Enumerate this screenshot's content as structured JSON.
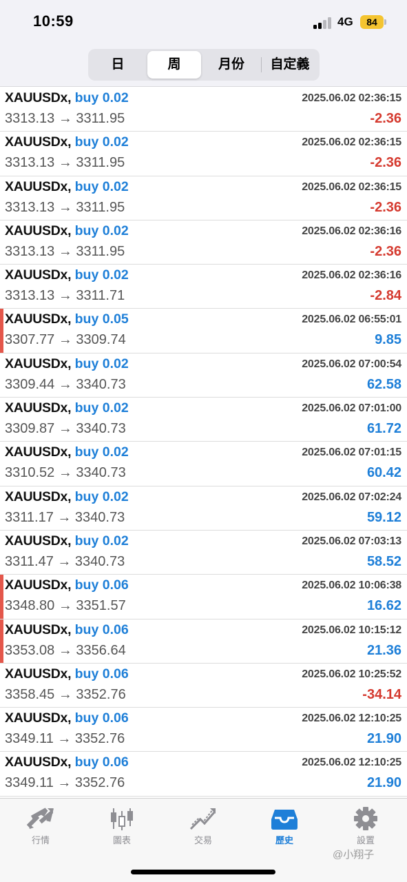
{
  "status": {
    "time": "10:59",
    "network": "4G",
    "battery": "84"
  },
  "period_tabs": [
    {
      "label": "日",
      "active": false
    },
    {
      "label": "周",
      "active": true
    },
    {
      "label": "月份",
      "active": false
    },
    {
      "label": "自定義",
      "active": false
    }
  ],
  "deals": [
    {
      "symbol": "XAUUSDx,",
      "type_volume": "buy 0.02",
      "time": "2025.06.02 02:36:15",
      "prices": "3313.13 → 3311.95",
      "profit": "-2.36",
      "profit_sign": "neg",
      "marked": false
    },
    {
      "symbol": "XAUUSDx,",
      "type_volume": "buy 0.02",
      "time": "2025.06.02 02:36:15",
      "prices": "3313.13 → 3311.95",
      "profit": "-2.36",
      "profit_sign": "neg",
      "marked": false
    },
    {
      "symbol": "XAUUSDx,",
      "type_volume": "buy 0.02",
      "time": "2025.06.02 02:36:15",
      "prices": "3313.13 → 3311.95",
      "profit": "-2.36",
      "profit_sign": "neg",
      "marked": false
    },
    {
      "symbol": "XAUUSDx,",
      "type_volume": "buy 0.02",
      "time": "2025.06.02 02:36:16",
      "prices": "3313.13 → 3311.95",
      "profit": "-2.36",
      "profit_sign": "neg",
      "marked": false
    },
    {
      "symbol": "XAUUSDx,",
      "type_volume": "buy 0.02",
      "time": "2025.06.02 02:36:16",
      "prices": "3313.13 → 3311.71",
      "profit": "-2.84",
      "profit_sign": "neg",
      "marked": false
    },
    {
      "symbol": "XAUUSDx,",
      "type_volume": "buy 0.05",
      "time": "2025.06.02 06:55:01",
      "prices": "3307.77 → 3309.74",
      "profit": "9.85",
      "profit_sign": "pos",
      "marked": true
    },
    {
      "symbol": "XAUUSDx,",
      "type_volume": "buy 0.02",
      "time": "2025.06.02 07:00:54",
      "prices": "3309.44 → 3340.73",
      "profit": "62.58",
      "profit_sign": "pos",
      "marked": false
    },
    {
      "symbol": "XAUUSDx,",
      "type_volume": "buy 0.02",
      "time": "2025.06.02 07:01:00",
      "prices": "3309.87 → 3340.73",
      "profit": "61.72",
      "profit_sign": "pos",
      "marked": false
    },
    {
      "symbol": "XAUUSDx,",
      "type_volume": "buy 0.02",
      "time": "2025.06.02 07:01:15",
      "prices": "3310.52 → 3340.73",
      "profit": "60.42",
      "profit_sign": "pos",
      "marked": false
    },
    {
      "symbol": "XAUUSDx,",
      "type_volume": "buy 0.02",
      "time": "2025.06.02 07:02:24",
      "prices": "3311.17 → 3340.73",
      "profit": "59.12",
      "profit_sign": "pos",
      "marked": false
    },
    {
      "symbol": "XAUUSDx,",
      "type_volume": "buy 0.02",
      "time": "2025.06.02 07:03:13",
      "prices": "3311.47 → 3340.73",
      "profit": "58.52",
      "profit_sign": "pos",
      "marked": false
    },
    {
      "symbol": "XAUUSDx,",
      "type_volume": "buy 0.06",
      "time": "2025.06.02 10:06:38",
      "prices": "3348.80 → 3351.57",
      "profit": "16.62",
      "profit_sign": "pos",
      "marked": true
    },
    {
      "symbol": "XAUUSDx,",
      "type_volume": "buy 0.06",
      "time": "2025.06.02 10:15:12",
      "prices": "3353.08 → 3356.64",
      "profit": "21.36",
      "profit_sign": "pos",
      "marked": true
    },
    {
      "symbol": "XAUUSDx,",
      "type_volume": "buy 0.06",
      "time": "2025.06.02 10:25:52",
      "prices": "3358.45 → 3352.76",
      "profit": "-34.14",
      "profit_sign": "neg",
      "marked": false
    },
    {
      "symbol": "XAUUSDx,",
      "type_volume": "buy 0.06",
      "time": "2025.06.02 12:10:25",
      "prices": "3349.11 → 3352.76",
      "profit": "21.90",
      "profit_sign": "pos",
      "marked": false
    },
    {
      "symbol": "XAUUSDx,",
      "type_volume": "buy 0.06",
      "time": "2025.06.02 12:10:25",
      "prices": "3349.11 → 3352.76",
      "profit": "21.90",
      "profit_sign": "pos",
      "marked": false
    }
  ],
  "tab_bar": [
    {
      "label": "行情",
      "icon": "quotes-icon",
      "active": false
    },
    {
      "label": "圖表",
      "icon": "chart-icon",
      "active": false
    },
    {
      "label": "交易",
      "icon": "trade-icon",
      "active": false
    },
    {
      "label": "歷史",
      "icon": "history-icon",
      "active": true
    },
    {
      "label": "設置",
      "icon": "settings-icon",
      "active": false
    }
  ],
  "watermark": "@小翔子",
  "colors": {
    "accent": "#1e7fd8",
    "loss": "#d53a2f",
    "marker": "#e4574b",
    "battery": "#f4c430"
  }
}
